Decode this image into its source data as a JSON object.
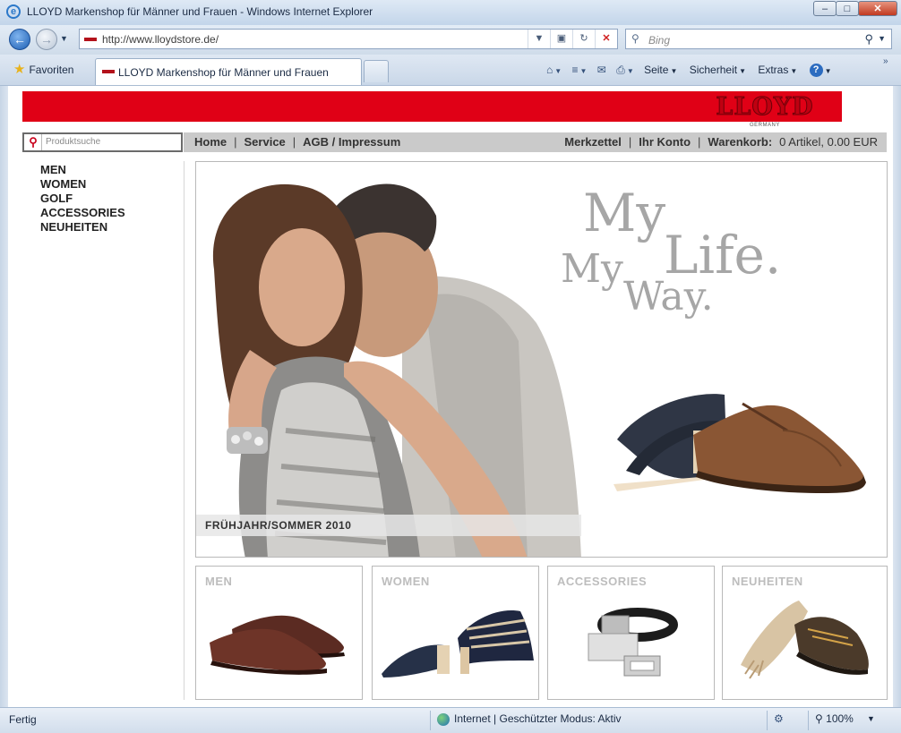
{
  "window": {
    "title": "LLOYD Markenshop für Männer und Frauen - Windows Internet Explorer",
    "controls": {
      "minimize": "–",
      "maximize": "□",
      "close": "✕"
    }
  },
  "address_bar": {
    "url": "http://www.lloydstore.de/",
    "search_placeholder": "Bing"
  },
  "favorites": {
    "label": "Favoriten"
  },
  "tab": {
    "label": "LLOYD Markenshop für Männer und Frauen"
  },
  "command_bar": {
    "page": "Seite",
    "safety": "Sicherheit",
    "extras": "Extras",
    "help": "?"
  },
  "site": {
    "logo_text": "LLOYD",
    "logo_sub": "GERMANY",
    "brand_color": "#e00016",
    "search_placeholder": "Produktsuche",
    "top_nav": [
      "Home",
      "Service",
      "AGB / Impressum"
    ],
    "account_nav": [
      "Merkzettel",
      "Ihr Konto",
      "Warenkorb:"
    ],
    "cart_summary": "0 Artikel, 0.00 EUR",
    "side_nav": [
      "MEN",
      "WOMEN",
      "GOLF",
      "ACCESSORIES",
      "NEUHEITEN"
    ],
    "hero": {
      "slogan": [
        "My",
        "My",
        "Life.",
        "Way."
      ],
      "season": "FRÜHJAHR/SOMMER 2010"
    },
    "tiles": [
      "MEN",
      "WOMEN",
      "ACCESSORIES",
      "NEUHEITEN"
    ]
  },
  "status_bar": {
    "status": "Fertig",
    "zone": "Internet | Geschützter Modus: Aktiv",
    "zoom": "100%"
  }
}
